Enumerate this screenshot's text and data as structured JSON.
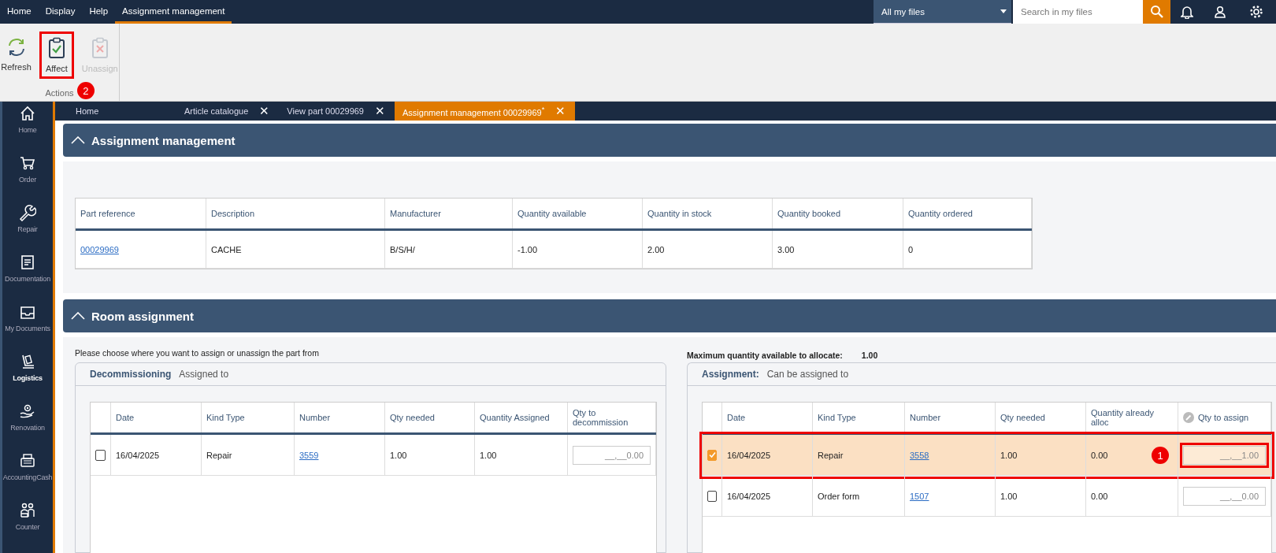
{
  "menu": [
    {
      "label": "Home",
      "selected": false
    },
    {
      "label": "Display",
      "selected": false
    },
    {
      "label": "Help",
      "selected": false
    },
    {
      "label": "Assignment management",
      "selected": true
    }
  ],
  "scope_select": {
    "value": "All my files"
  },
  "search": {
    "placeholder": "Search in my files"
  },
  "ribbon": {
    "group_label": "Actions",
    "buttons": [
      {
        "kind": "refresh",
        "label": "Refresh",
        "disabled": false,
        "highlighted": false
      },
      {
        "kind": "affect",
        "label": "Affect",
        "disabled": false,
        "highlighted": true,
        "callout": "2"
      },
      {
        "kind": "unassign",
        "label": "Unassign",
        "disabled": true,
        "highlighted": false
      }
    ]
  },
  "sidebar": {
    "items": [
      {
        "kind": "home",
        "label": "Home",
        "selected": false
      },
      {
        "kind": "order",
        "label": "Order",
        "selected": false
      },
      {
        "kind": "repair",
        "label": "Repair",
        "selected": false
      },
      {
        "kind": "documentation",
        "label": "Documentation",
        "selected": false
      },
      {
        "kind": "documents",
        "label": "My Documents",
        "selected": false
      },
      {
        "kind": "logistics",
        "label": "Logistics",
        "selected": true
      },
      {
        "kind": "renovation",
        "label": "Renovation",
        "selected": false
      },
      {
        "kind": "cash",
        "label": "AccountingCash",
        "selected": false
      },
      {
        "kind": "counter",
        "label": "Counter",
        "selected": false
      }
    ]
  },
  "tabs": [
    {
      "label": "Home",
      "selected": false
    },
    {
      "label": "Article catalogue",
      "close": "✕",
      "selected": false
    },
    {
      "label": "View part 00029969",
      "close": "✕",
      "selected": false
    },
    {
      "label": "Assignment management 00029969$^{*}$",
      "close": "✕",
      "selected": true
    }
  ],
  "part_section": {
    "title": "Assignment management",
    "columns": [
      {
        "label": "Part reference",
        "kind": "link"
      },
      {
        "label": "Description",
        "kind": "text"
      },
      {
        "label": "Manufacturer",
        "kind": "text"
      },
      {
        "label": "Quantity available",
        "kind": "text"
      },
      {
        "label": "Quantity in stock",
        "kind": "text"
      },
      {
        "label": "Quantity booked",
        "kind": "text"
      },
      {
        "label": "Quantity ordered",
        "kind": "text"
      }
    ],
    "rows": [
      [
        "00029969",
        "CACHE",
        "B/S/H/",
        "-1.00",
        "2.00",
        "3.00",
        "0"
      ]
    ]
  },
  "room_section": {
    "title": "Room assignment",
    "instruction": "Please choose where you want to assign or unassign the part from",
    "max_label": "Maximum quantity available to allocate:",
    "max_value": "1.00",
    "panels": [
      {
        "title": "Decommissioning",
        "subtitle": "Assigned to",
        "columns": [
          {
            "label": "Date",
            "kind": "text"
          },
          {
            "label": "Kind Type",
            "kind": "text"
          },
          {
            "label": "Number",
            "kind": "link"
          },
          {
            "label": "Qty needed",
            "kind": "text"
          },
          {
            "label": "Quantity Assigned",
            "kind": "text"
          },
          {
            "label": "Qty to decommission",
            "kind": "input",
            "with_icon": false
          }
        ],
        "rows": [
          {
            "checked": false,
            "highlighted": false,
            "cells": [
              "16/04/2025",
              "Repair",
              "3559",
              "1.00",
              "1.00",
              "__,__0.00"
            ]
          }
        ]
      },
      {
        "title": "Assignment:",
        "subtitle": "Can be assigned to",
        "columns": [
          {
            "label": "Date",
            "kind": "text"
          },
          {
            "label": "Kind Type",
            "kind": "text"
          },
          {
            "label": "Number",
            "kind": "link"
          },
          {
            "label": "Qty needed",
            "kind": "text"
          },
          {
            "label": "Quantity already alloc",
            "kind": "text"
          },
          {
            "label": "Qty to assign",
            "kind": "input",
            "with_icon": true
          }
        ],
        "rows": [
          {
            "checked": true,
            "highlighted": true,
            "callout": "1",
            "cells": [
              "16/04/2025",
              "Repair",
              "3558",
              "1.00",
              "0.00",
              "__,__1.00"
            ]
          },
          {
            "checked": false,
            "highlighted": false,
            "cells": [
              "16/04/2025",
              "Order form",
              "1507",
              "1.00",
              "0.00",
              "__,__0.00"
            ]
          }
        ]
      }
    ]
  }
}
